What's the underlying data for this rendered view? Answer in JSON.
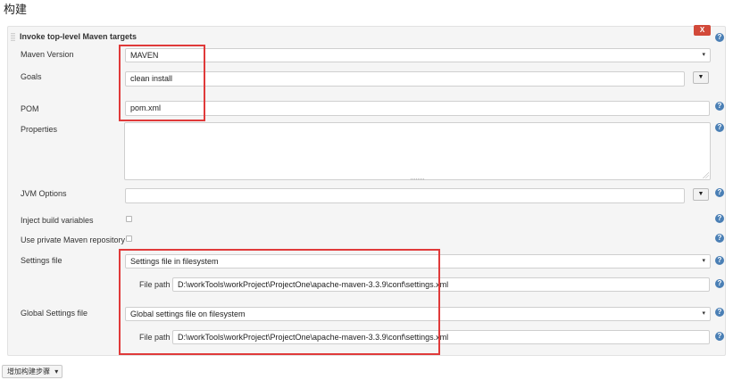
{
  "section_title": "构建",
  "panel": {
    "title": "Invoke top-level Maven targets",
    "delete_label": "X"
  },
  "help_glyph": "?",
  "maven_version": {
    "label": "Maven Version",
    "value": "MAVEN",
    "arrow": "▾"
  },
  "goals": {
    "label": "Goals",
    "value": "clean install",
    "button": "▼"
  },
  "pom": {
    "label": "POM",
    "value": "pom.xml"
  },
  "properties": {
    "label": "Properties",
    "value": ""
  },
  "jvm_options": {
    "label": "JVM Options",
    "value": "",
    "button": "▼"
  },
  "inject_build_variables": {
    "label": "Inject build variables",
    "checked": false
  },
  "private_repo": {
    "label": "Use private Maven repository",
    "checked": false
  },
  "settings_file": {
    "label": "Settings file",
    "value": "Settings file in filesystem",
    "arrow": "▾",
    "file_path_label": "File path",
    "file_path_value": "D:\\workTools\\workProject\\ProjectOne\\apache-maven-3.3.9\\conf\\settings.xml"
  },
  "global_settings_file": {
    "label": "Global Settings file",
    "value": "Global settings file on filesystem",
    "arrow": "▾",
    "file_path_label": "File path",
    "file_path_value": "D:\\workTools\\workProject\\ProjectOne\\apache-maven-3.3.9\\conf\\settings.xml"
  },
  "add_build_step": {
    "label": "增加构建步骤",
    "arrow": "▾"
  },
  "colors": {
    "accent_red": "#e03a3a",
    "delete_button": "#d24939",
    "help_blue": "#4a7fb5"
  }
}
